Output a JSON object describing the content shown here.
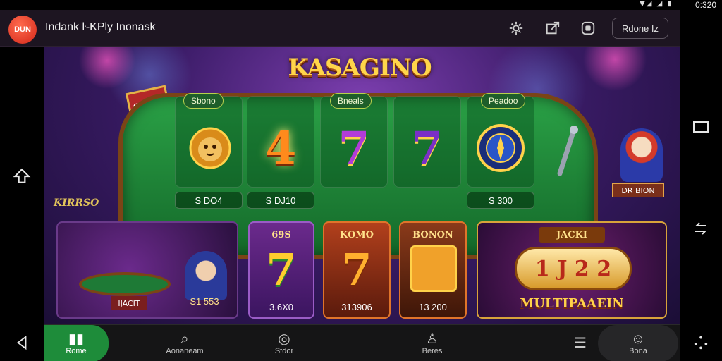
{
  "status": {
    "time": "0:320",
    "icons": "▼◢ ◢ ▮"
  },
  "app": {
    "logo_text": "DUN",
    "title": "Indank ŀ-KPly Inonask",
    "header_button": "Rdone Iz",
    "icons": [
      "settings-gear-icon",
      "share-icon",
      "record-icon"
    ]
  },
  "system_nav": {
    "left_icon": "home-up-arrow-icon",
    "right_top_icon": "recents-square-icon",
    "right_mid_icon": "rotate-icon",
    "back_icon": "back-triangle-icon",
    "menu_icon": "more-dots-icon"
  },
  "game": {
    "brand": "KASAGINO",
    "table_sign": "S110",
    "side_tag": "KIRRSO",
    "clown_tag": "DR BION",
    "slots": [
      {
        "header": "Sbono",
        "symbol": "lion-icon",
        "price": "S DO4"
      },
      {
        "header": "",
        "symbol": "4",
        "price": "S DJ10"
      },
      {
        "header": "Bneals",
        "symbol": "7",
        "price": ""
      },
      {
        "header": "",
        "symbol": "7",
        "price": ""
      },
      {
        "header": "Peadoo",
        "symbol": "compass-wheel-icon",
        "price": "S 300"
      }
    ],
    "tiles": [
      {
        "title": "",
        "label": "S1 553",
        "sign": "IJACIT"
      },
      {
        "title": "69S",
        "symbol": "7",
        "label": "3.6X0"
      },
      {
        "title": "KOMO",
        "symbol": "7",
        "label": "313906"
      },
      {
        "title": "BONON",
        "symbol": "face-icon",
        "label": "13 200"
      },
      {
        "title": "JACKI",
        "label": "MULTIPAAEIN",
        "reel": "1 J 2 2"
      }
    ]
  },
  "bottom_nav": [
    {
      "label": "Rome",
      "icon": "home-icon",
      "active": true
    },
    {
      "label": "Aonaneam",
      "icon": "search-icon"
    },
    {
      "label": "Stdor",
      "icon": "location-pin-icon"
    },
    {
      "label": "Beres",
      "icon": "person-icon"
    },
    {
      "label": "",
      "icon": "list-icon"
    },
    {
      "label": "Bona",
      "icon": "person-circle-icon"
    }
  ]
}
